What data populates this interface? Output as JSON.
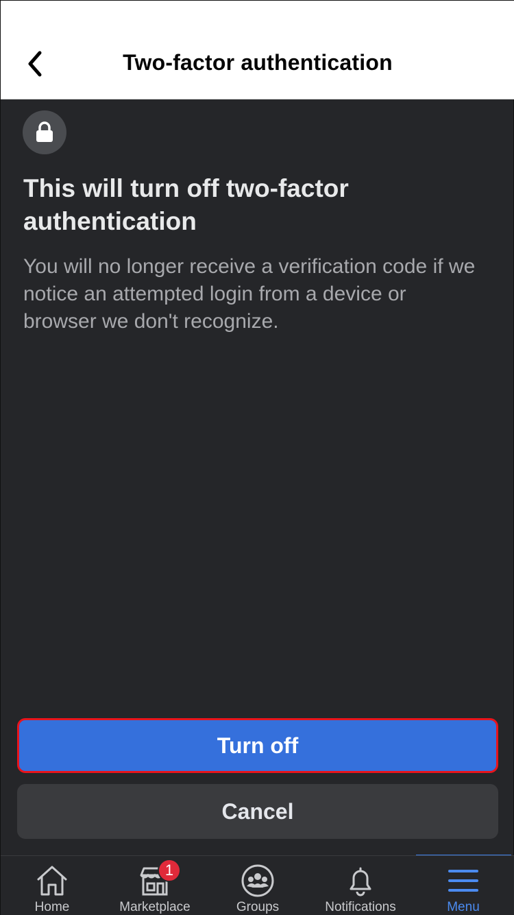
{
  "header": {
    "title": "Two-factor authentication",
    "back_icon": "chevron-left-icon"
  },
  "content": {
    "icon": "lock-icon",
    "title": "This will turn off two-factor authentication",
    "description": "You will no longer receive a verification code if we notice an attempted login from a device or browser we don't recognize."
  },
  "actions": {
    "primary_label": "Turn off",
    "secondary_label": "Cancel"
  },
  "tabbar": {
    "items": [
      {
        "label": "Home",
        "icon": "home-icon"
      },
      {
        "label": "Marketplace",
        "icon": "marketplace-icon",
        "badge": "1"
      },
      {
        "label": "Groups",
        "icon": "groups-icon"
      },
      {
        "label": "Notifications",
        "icon": "bell-icon"
      },
      {
        "label": "Menu",
        "icon": "menu-icon",
        "active": true
      }
    ]
  },
  "colors": {
    "accent": "#3570dc",
    "highlight_border": "#e8141c",
    "background": "#252629",
    "active_tab": "#4b8bf0",
    "badge": "#e02a3a"
  }
}
